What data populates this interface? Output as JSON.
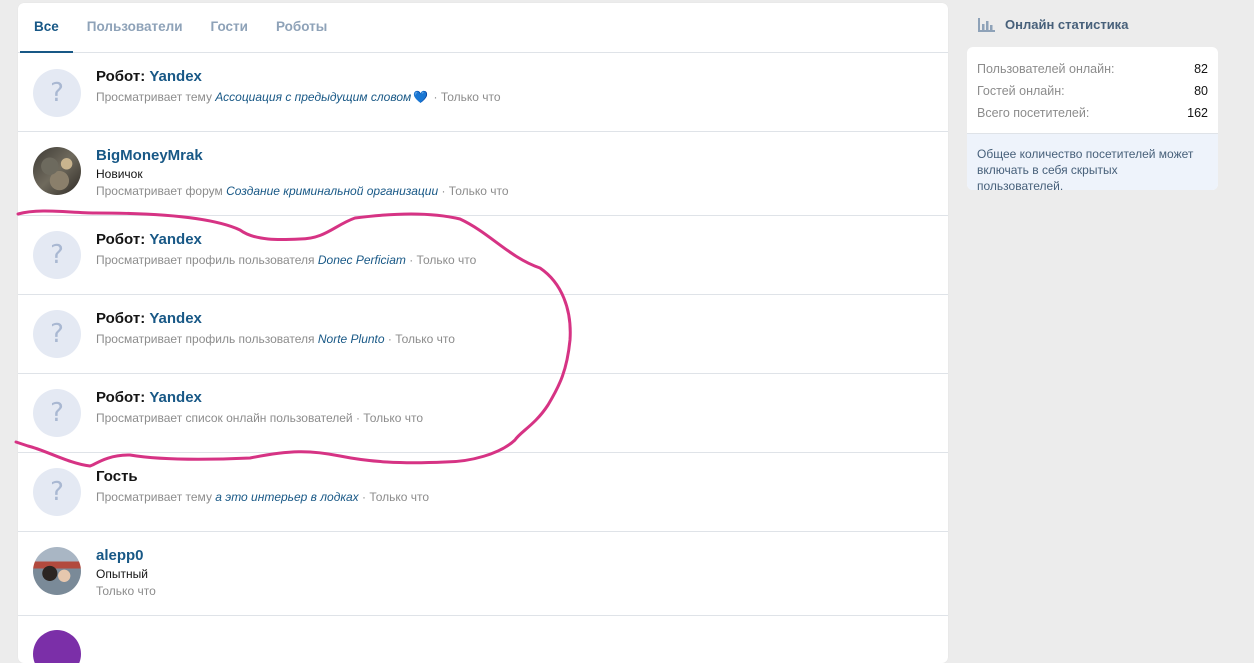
{
  "tabs": [
    "Все",
    "Пользователи",
    "Гости",
    "Роботы"
  ],
  "rows": [
    {
      "prefix": "Робот: ",
      "name": "Yandex",
      "rank": "",
      "meta_action": "Просматривает тему ",
      "meta_target": "Ассоциация с предыдущим словом",
      "meta_time": " · Только что",
      "avatar": "placeholder",
      "heart": true
    },
    {
      "prefix": "",
      "name": "BigMoneyMrak",
      "rank": "Новичок",
      "meta_action": "Просматривает форум ",
      "meta_target": "Создание криминальной организации",
      "meta_time": " · Только что",
      "avatar": "photo"
    },
    {
      "prefix": "Робот: ",
      "name": "Yandex",
      "rank": "",
      "meta_action": "Просматривает профиль пользователя ",
      "meta_target": "Donec Perficiam",
      "meta_time": " · Только что",
      "avatar": "placeholder"
    },
    {
      "prefix": "Робот: ",
      "name": "Yandex",
      "rank": "",
      "meta_action": "Просматривает профиль пользователя ",
      "meta_target": "Norte Plunto",
      "meta_time": " · Только что",
      "avatar": "placeholder"
    },
    {
      "prefix": "Робот: ",
      "name": "Yandex",
      "rank": "",
      "meta_action": "Просматривает список онлайн пользователей",
      "meta_target": "",
      "meta_time": " · Только что",
      "avatar": "placeholder"
    },
    {
      "prefix": "",
      "name": "Гость",
      "rank": "",
      "meta_action": "Просматривает тему ",
      "meta_target": "а это интерьер в лодках",
      "meta_time": " · Только что",
      "avatar": "placeholder",
      "guest": true
    },
    {
      "prefix": "",
      "name": "alepp0",
      "rank": "Опытный",
      "meta_action": "",
      "meta_target": "",
      "meta_time": "Только что",
      "avatar": "photo"
    }
  ],
  "sidebar": {
    "title": "Онлайн статистика",
    "stats": [
      {
        "label": "Пользователей онлайн:",
        "value": "82"
      },
      {
        "label": "Гостей онлайн:",
        "value": "80"
      },
      {
        "label": "Всего посетителей:",
        "value": "162"
      }
    ],
    "note": "Общее количество посетителей может включать в себя скрытых пользователей."
  },
  "icons": {
    "placeholder": "question-mark-icon",
    "heart": "heart-icon",
    "stats": "bar-chart-icon"
  },
  "colors": {
    "accent": "#185886",
    "muted": "#8c8c8c",
    "scribble": "#d63384",
    "tab_inactive": "#8ea2b8"
  }
}
